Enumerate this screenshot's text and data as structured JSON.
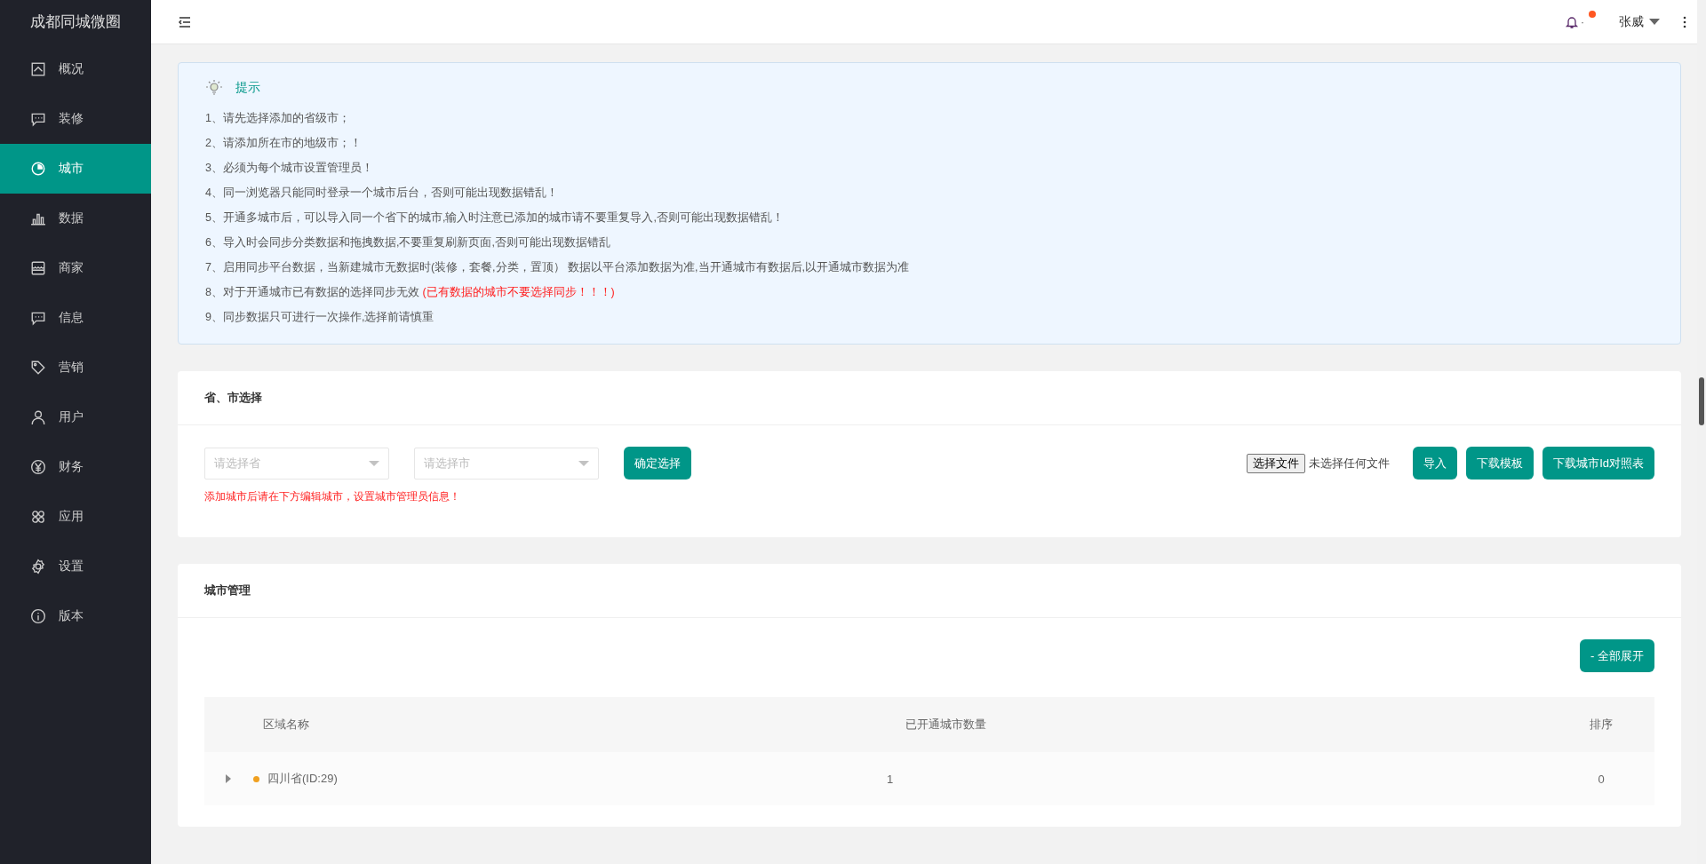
{
  "sidebar": {
    "title": "成都同城微圈",
    "items": [
      {
        "label": "概况",
        "kind": "overview",
        "selected": false
      },
      {
        "label": "装修",
        "kind": "chat",
        "selected": false
      },
      {
        "label": "城市",
        "kind": "city",
        "selected": true
      },
      {
        "label": "数据",
        "kind": "bars",
        "selected": false
      },
      {
        "label": "商家",
        "kind": "shop",
        "selected": false
      },
      {
        "label": "信息",
        "kind": "chat",
        "selected": false
      },
      {
        "label": "营销",
        "kind": "tag",
        "selected": false
      },
      {
        "label": "用户",
        "kind": "user",
        "selected": false
      },
      {
        "label": "财务",
        "kind": "yen",
        "selected": false
      },
      {
        "label": "应用",
        "kind": "apps",
        "selected": false
      },
      {
        "label": "设置",
        "kind": "gear",
        "selected": false
      },
      {
        "label": "版本",
        "kind": "info",
        "selected": false
      }
    ]
  },
  "header": {
    "notification_separator": "·",
    "has_unread": true,
    "user": "张威"
  },
  "tips": {
    "title": "提示",
    "items": [
      {
        "text": "1、请先选择添加的省级市；"
      },
      {
        "text": "2、请添加所在市的地级市；！"
      },
      {
        "text": "3、必须为每个城市设置管理员！"
      },
      {
        "text": "4、同一浏览器只能同时登录一个城市后台，否则可能出现数据错乱！"
      },
      {
        "text": "5、开通多城市后，可以导入同一个省下的城市,输入时注意已添加的城市请不要重复导入,否则可能出现数据错乱！"
      },
      {
        "text": "6、导入时会同步分类数据和拖拽数据,不要重复刷新页面,否则可能出现数据错乱"
      },
      {
        "text": "7、启用同步平台数据，当新建城市无数据时(装修，套餐,分类，置顶） 数据以平台添加数据为准,当开通城市有数据后,以开通城市数据为准"
      },
      {
        "text": "8、对于开通城市已有数据的选择同步无效",
        "warning": "(已有数据的城市不要选择同步！！！)"
      },
      {
        "text": "9、同步数据只可进行一次操作,选择前请慎重"
      }
    ]
  },
  "region_select": {
    "title": "省、市选择",
    "province": {
      "placeholder": "请选择省"
    },
    "city": {
      "placeholder": "请选择市"
    },
    "confirm": "确定选择",
    "hint": "添加城市后请在下方编辑城市，设置城市管理员信息！",
    "file_button": "选择文件",
    "file_status": "未选择任何文件",
    "actions": [
      "导入",
      "下载模板",
      "下载城市Id对照表"
    ]
  },
  "city_management": {
    "title": "城市管理",
    "expand_button": "- 全部展开",
    "table": {
      "columns": [
        "区域名称",
        "已开通城市数量",
        "排序"
      ],
      "rows": [
        {
          "name": "四川省(ID:29)",
          "expanded": false,
          "color": "#f0a020",
          "count": "1",
          "order": "0"
        }
      ]
    }
  }
}
